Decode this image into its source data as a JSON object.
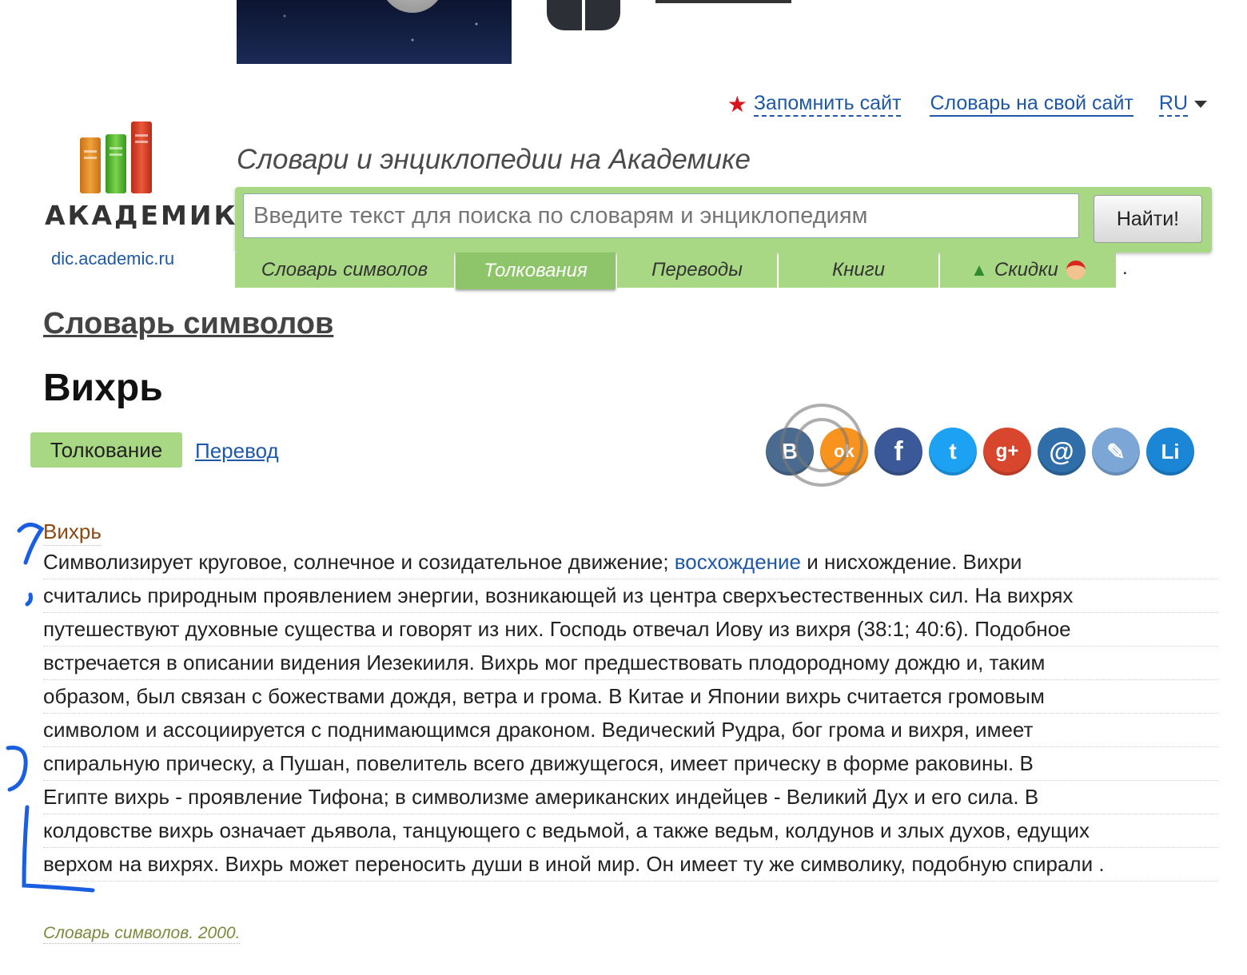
{
  "header": {
    "remember_site": "Запомнить сайт",
    "dict_for_site": "Словарь на свой сайт",
    "language": "RU",
    "tagline": "Словари и энциклопедии на Академике"
  },
  "logo": {
    "word": "АКАДЕМИК",
    "url": "dic.academic.ru"
  },
  "search": {
    "placeholder": "Введите текст для поиска по словарям и энциклопедиям",
    "button": "Найти!"
  },
  "tabs": [
    {
      "label": "Словарь символов"
    },
    {
      "label": "Толкования"
    },
    {
      "label": "Переводы"
    },
    {
      "label": "Книги"
    },
    {
      "label": "Скидки"
    }
  ],
  "page": {
    "dictionary_title": "Словарь символов",
    "word": "Вихрь",
    "mode_active": "Толкование",
    "mode_link": "Перевод"
  },
  "social": [
    {
      "name": "vk",
      "glyph": "В",
      "color": "#4a6b8f"
    },
    {
      "name": "odnoklassniki",
      "glyph": "ok",
      "color": "#f7931e"
    },
    {
      "name": "facebook",
      "glyph": "f",
      "color": "#3b5998"
    },
    {
      "name": "twitter",
      "glyph": "t",
      "color": "#1da1f2"
    },
    {
      "name": "google-plus",
      "glyph": "g+",
      "color": "#d8462e"
    },
    {
      "name": "mail",
      "glyph": "@",
      "color": "#2f6ea8"
    },
    {
      "name": "livejournal",
      "glyph": "✎",
      "color": "#7ba6d6"
    },
    {
      "name": "liveinternet",
      "glyph": "Li",
      "color": "#1b86d6"
    }
  ],
  "article": {
    "entry_word": "Вихрь",
    "line1_a": "Символизирует круговое, солнечное и созидательное движение; ",
    "line1_link": "восхождение",
    "line1_b": " и нисхождение. Вихри",
    "lines": [
      "считались природным проявлением энергии, возникающей из центра сверхъестественных сил. На вихрях",
      "путешествуют духовные существа и говорят из них. Господь отвечал Иову из вихря (38:1; 40:6). Подобное",
      "встречается в описании видения Иезекииля. Вихрь мог предшествовать плодородному дождю и, таким",
      "образом, был связан с божествами дождя, ветра и грома. В Китае и Японии вихрь считается громовым",
      "символом и ассоциируется с поднимающимся драконом. Ведический Рудра, бог грома и вихря, имеет",
      "спиральную прическу, а Пушан, повелитель всего движущегося, имеет прическу в форме раковины. В",
      "Египте вихрь - проявление Тифона; в символизме американских индейцев - Великий Дух и его сила. В",
      "колдовстве вихрь означает дьявола, танцующего с ведьмой, а также ведьм, колдунов и злых духов, едущих",
      "верхом на вихрях. Вихрь может переносить души в иной мир. Он имеет ту же символику, подобную спирали ."
    ],
    "source": "Словарь символов. 2000."
  },
  "colors": {
    "accent_green": "#a9d884",
    "link_blue": "#1f58a6",
    "entry_brown": "#8a4a12"
  }
}
